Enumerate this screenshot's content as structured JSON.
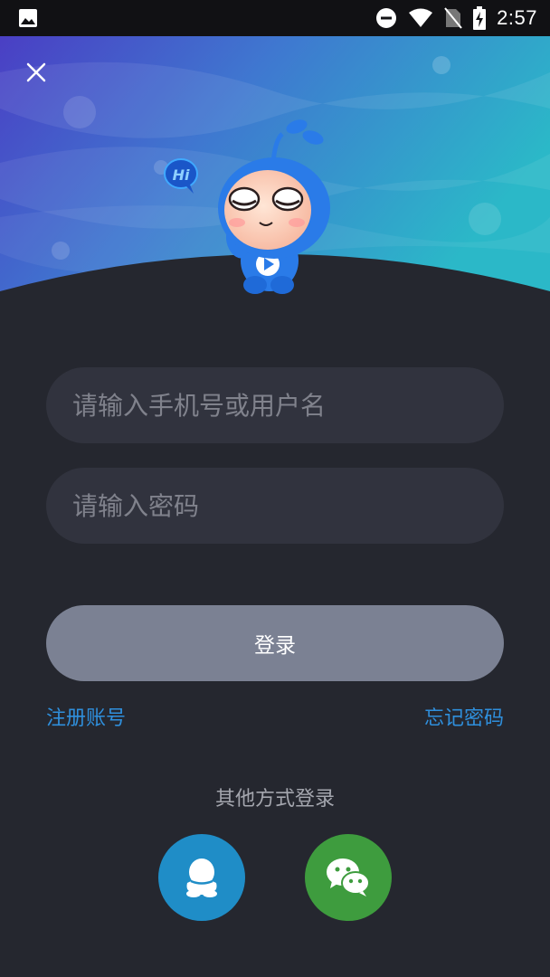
{
  "status_bar": {
    "time": "2:57",
    "icons": [
      "image-icon",
      "do-not-disturb-icon",
      "wifi-icon",
      "no-sim-icon",
      "battery-charging-icon"
    ]
  },
  "hero": {
    "close_icon": "close-icon",
    "mascot_greeting": "Hi",
    "colors": {
      "top_left": "#4a3fc4",
      "top_right": "#2bb8c8"
    }
  },
  "form": {
    "username_placeholder": "请输入手机号或用户名",
    "password_placeholder": "请输入密码",
    "login_label": "登录"
  },
  "links": {
    "register": "注册账号",
    "forgot": "忘记密码"
  },
  "other_login": {
    "label": "其他方式登录",
    "providers": [
      "qq-icon",
      "wechat-icon"
    ]
  },
  "colors": {
    "background": "#25272f",
    "field": "#31333e",
    "button": "#7b8193",
    "link": "#2f8fdc",
    "qq": "#1f8dc7",
    "wechat": "#3e9c3e"
  }
}
